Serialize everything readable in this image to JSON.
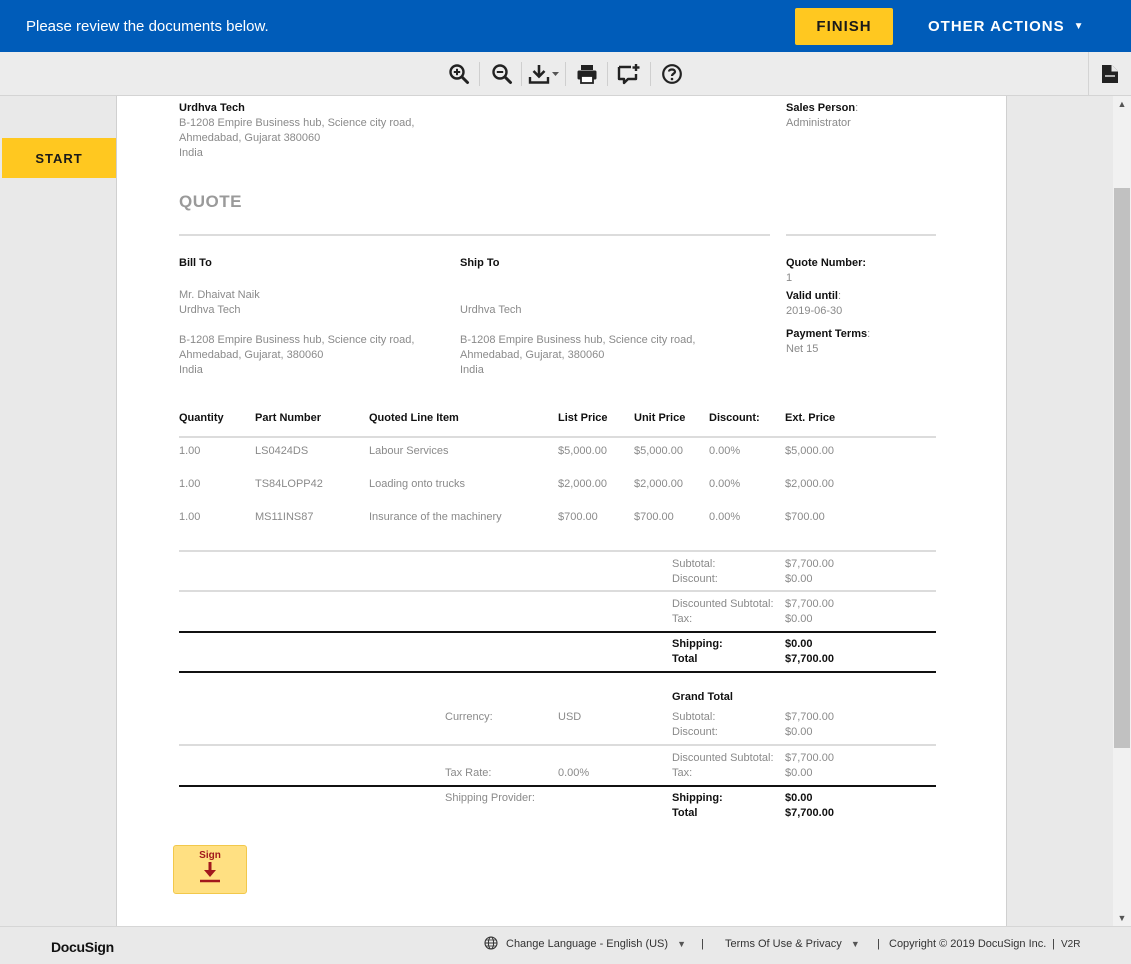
{
  "header": {
    "message": "Please review the documents below.",
    "finish_label": "FINISH",
    "other_actions_label": "OTHER ACTIONS"
  },
  "toolbar": {
    "tools": [
      "zoom-in-icon",
      "zoom-out-icon",
      "download-icon",
      "print-icon",
      "comment-icon",
      "help-icon"
    ]
  },
  "start_label": "START",
  "document": {
    "company": {
      "name": "Urdhva Tech",
      "address": [
        "B-1208 Empire Business hub, Science city road,",
        "Ahmedabad, Gujarat 380060",
        "India"
      ]
    },
    "sales_person": {
      "label": "Sales Person",
      "value": "Administrator"
    },
    "title": "QUOTE",
    "bill_to": {
      "label": "Bill To",
      "lines": [
        "Mr. Dhaivat Naik",
        "Urdhva Tech"
      ],
      "address": [
        "B-1208 Empire Business hub, Science city road,",
        "Ahmedabad, Gujarat, 380060",
        "India"
      ]
    },
    "ship_to": {
      "label": "Ship To",
      "lines": [
        "Urdhva Tech"
      ],
      "address": [
        "B-1208 Empire Business hub, Science city road,",
        "Ahmedabad, Gujarat, 380060",
        "India"
      ]
    },
    "meta": {
      "quote_number_label": "Quote Number:",
      "quote_number": "1",
      "valid_until_label": "Valid until",
      "valid_until": "2019-06-30",
      "payment_terms_label": "Payment Terms",
      "payment_terms": "Net 15"
    },
    "line_items": {
      "headers": [
        "Quantity",
        "Part Number",
        "Quoted Line Item",
        "List Price",
        "Unit Price",
        "Discount:",
        "Ext. Price"
      ],
      "rows": [
        [
          "1.00",
          "LS0424DS",
          "Labour Services",
          "$5,000.00",
          "$5,000.00",
          "0.00%",
          "$5,000.00"
        ],
        [
          "1.00",
          "TS84LOPP42",
          "Loading onto trucks",
          "$2,000.00",
          "$2,000.00",
          "0.00%",
          "$2,000.00"
        ],
        [
          "1.00",
          "MS11INS87",
          "Insurance of the machinery",
          "$700.00",
          "$700.00",
          "0.00%",
          "$700.00"
        ]
      ]
    },
    "group_totals": {
      "subtotal_label": "Subtotal:",
      "subtotal": "$7,700.00",
      "discount_label": "Discount:",
      "discount": "$0.00",
      "disc_subtotal_label": "Discounted Subtotal:",
      "disc_subtotal": "$7,700.00",
      "tax_label": "Tax:",
      "tax": "$0.00",
      "shipping_label": "Shipping:",
      "shipping": "$0.00",
      "total_label": "Total",
      "total": "$7,700.00"
    },
    "grand_total": {
      "heading": "Grand Total",
      "currency_label": "Currency:",
      "currency": "USD",
      "subtotal_label": "Subtotal:",
      "subtotal": "$7,700.00",
      "discount_label": "Discount:",
      "discount": "$0.00",
      "disc_subtotal_label": "Discounted Subtotal:",
      "disc_subtotal": "$7,700.00",
      "tax_rate_label": "Tax Rate:",
      "tax_rate": "0.00%",
      "tax_label": "Tax:",
      "tax": "$0.00",
      "shipping_provider_label": "Shipping Provider:",
      "shipping_label": "Shipping:",
      "shipping": "$0.00",
      "total_label": "Total",
      "total": "$7,700.00"
    },
    "sign_label": "Sign"
  },
  "footer": {
    "logo": "DocuSign",
    "language": "Change Language - English (US)",
    "terms": "Terms Of Use & Privacy",
    "copyright": "Copyright © 2019 DocuSign Inc.",
    "version": "V2R"
  },
  "colors": {
    "brand_blue": "#005cb9",
    "accent_yellow": "#ffc820",
    "sign_red": "#a1181d"
  }
}
